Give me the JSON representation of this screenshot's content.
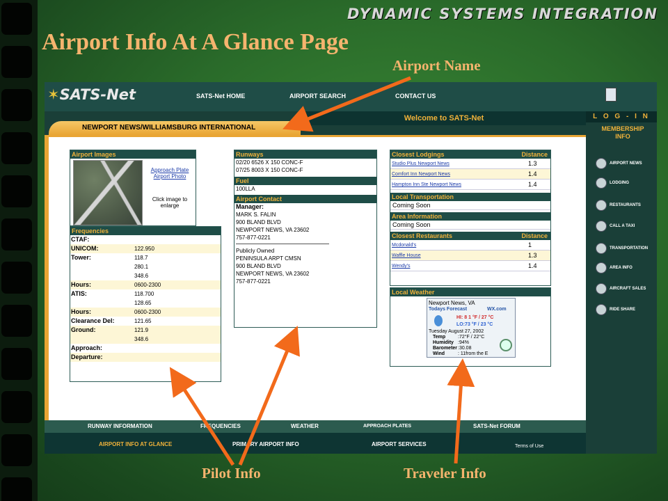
{
  "slide": {
    "brand": "DYNAMIC SYSTEMS INTEGRATION",
    "title": "Airport Info At A Glance Page",
    "callouts": {
      "airport_name": "Airport Name",
      "pilot_info": "Pilot Info",
      "traveler_info": "Traveler Info"
    },
    "accent_color": "#f5b46e",
    "arrow_color": "#f26a1b"
  },
  "site": {
    "logo": "SATS-Net",
    "nav": [
      "SATS-Net HOME",
      "AIRPORT SEARCH",
      "CONTACT US"
    ],
    "welcome": "Welcome to SATS-Net",
    "login": "L O G - I N",
    "membership": [
      "MEMBERSHIP",
      "INFO"
    ],
    "airport_name": "NEWPORT NEWS/WILLIAMSBURG INTERNATIONAL",
    "sidebar": [
      {
        "label": "AIRPORT NEWS",
        "icon": "paperclip-icon"
      },
      {
        "label": "LODGING",
        "icon": "bed-icon"
      },
      {
        "label": "RESTAURANTS",
        "icon": "fork-knife-icon"
      },
      {
        "label": "CALL A TAXI",
        "icon": "phone-icon"
      },
      {
        "label": "TRANSPORTATION",
        "icon": "plane-icon"
      },
      {
        "label": "AREA INFO",
        "icon": "info-icon"
      },
      {
        "label": "AIRCRAFT SALES",
        "icon": "dollar-icon"
      },
      {
        "label": "RIDE SHARE",
        "icon": "ride-share-icon"
      }
    ],
    "airport_images": {
      "header": "Airport Images",
      "links": [
        "Approach Plate",
        "Airport Photo"
      ],
      "enlarge": [
        "Click image to",
        "enlarge"
      ]
    },
    "frequencies": {
      "header": "Frequencies",
      "rows": [
        {
          "label": "CTAF:",
          "value": ""
        },
        {
          "label": "UNICOM:",
          "value": "122.950"
        },
        {
          "label": "Tower:",
          "value": "118.7"
        },
        {
          "label": "",
          "value": "280.1"
        },
        {
          "label": "",
          "value": "348.6"
        },
        {
          "label": "Hours:",
          "value": "0600-2300"
        },
        {
          "label": "ATIS:",
          "value": "118.700"
        },
        {
          "label": "",
          "value": "128.65"
        },
        {
          "label": "Hours:",
          "value": "0600-2300"
        },
        {
          "label": "Clearance Del:",
          "value": "121.65"
        },
        {
          "label": "Ground:",
          "value": "121.9"
        },
        {
          "label": "",
          "value": "348.6"
        },
        {
          "label": "Approach:",
          "value": ""
        },
        {
          "label": "Departure:",
          "value": ""
        }
      ]
    },
    "runways": {
      "header": "Runways",
      "rows": [
        "02/20 6526 X 150 CONC-F",
        "07/25 8003 X 150 CONC-F"
      ]
    },
    "fuel": {
      "header": "Fuel",
      "value": "100LLA"
    },
    "contact": {
      "header": "Airport Contact",
      "manager_label": "Manager:",
      "manager": [
        "MARK S. FALIN",
        "900 BLAND BLVD",
        "NEWPORT NEWS, VA 23602",
        "757-877-0221"
      ],
      "owner": [
        "Publicly Owned",
        "PENINSULA ARPT CMSN",
        "900 BLAND BLVD",
        "NEWPORT NEWS, VA 23602",
        "757-877-0221"
      ]
    },
    "lodgings": {
      "header": "Closest Lodgings",
      "dist_header": "Distance",
      "rows": [
        {
          "name": "Studio Plus Newport News",
          "dist": "1.3"
        },
        {
          "name": "Comfort Inn Newport News",
          "dist": "1.4"
        },
        {
          "name": "Hampton Inn Ste Newport News",
          "dist": "1.4"
        }
      ]
    },
    "transportation": {
      "header": "Local Transportation",
      "value": "Coming Soon"
    },
    "area": {
      "header": "Area Information",
      "value": "Coming Soon"
    },
    "restaurants": {
      "header": "Closest Restaurants",
      "dist_header": "Distance",
      "rows": [
        {
          "name": "Mcdonald's",
          "dist": "1"
        },
        {
          "name": "Waffle House",
          "dist": "1.3"
        },
        {
          "name": "Wendy's",
          "dist": "1.4"
        }
      ]
    },
    "weather": {
      "header": "Local Weather",
      "city": "Newport News, VA",
      "forecast": "Todays Forecast",
      "source": "WX.com",
      "hi": "HI: 8 1 °F / 27 °C",
      "lo": "LO:73 °F / 23 °C",
      "date": "Tuesday August 27, 2002",
      "rows": [
        {
          "label": "Temp",
          "value": ":72°F  / 22°C"
        },
        {
          "label": "Humidity",
          "value": ":94%"
        },
        {
          "label": "Barometer",
          "value": ":30.08"
        },
        {
          "label": "Wind",
          "value": ": 11from the E"
        }
      ]
    },
    "bottom_nav_1": [
      "RUNWAY INFORMATION",
      "FREQUENCIES",
      "WEATHER",
      "APPROACH PLATES",
      "SATS-Net FORUM"
    ],
    "bottom_nav_2": [
      "AIRPORT INFO AT GLANCE",
      "PRIMARY AIRPORT INFO",
      "AIRPORT SERVICES"
    ],
    "terms": "Terms of Use"
  }
}
